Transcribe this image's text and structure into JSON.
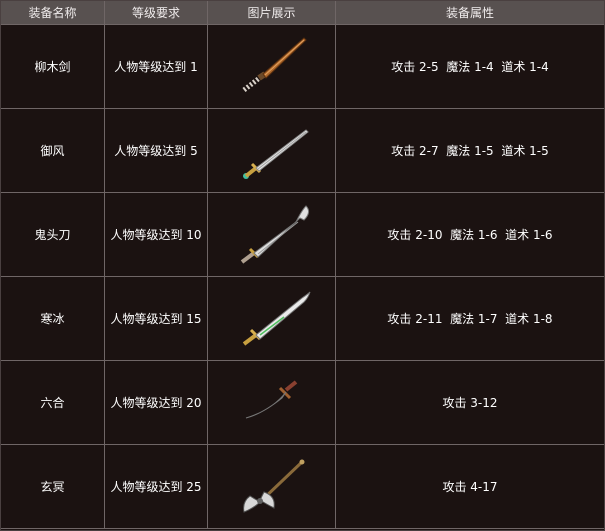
{
  "headers": [
    "装备名称",
    "等级要求",
    "图片展示",
    "装备属性"
  ],
  "rows": [
    {
      "name": "柳木剑",
      "level": "人物等级达到 1",
      "image": "wooden-sword-icon",
      "attributes": "攻击 2-5  魔法 1-4  道术 1-4"
    },
    {
      "name": "御风",
      "level": "人物等级达到 5",
      "image": "wind-sword-icon",
      "attributes": "攻击 2-7  魔法 1-5  道术 1-5"
    },
    {
      "name": "鬼头刀",
      "level": "人物等级达到 10",
      "image": "ghost-blade-icon",
      "attributes": "攻击 2-10  魔法 1-6  道术 1-6"
    },
    {
      "name": "寒冰",
      "level": "人物等级达到 15",
      "image": "ice-sword-icon",
      "attributes": "攻击 2-11  魔法 1-7  道术 1-8"
    },
    {
      "name": "六合",
      "level": "人物等级达到 20",
      "image": "liuhe-dagger-icon",
      "attributes": "攻击 3-12"
    },
    {
      "name": "玄冥",
      "level": "人物等级达到 25",
      "image": "xuanming-axe-icon",
      "attributes": "攻击 4-17"
    }
  ],
  "colors": {
    "header_bg": "#585150",
    "body_bg": "#1b1211",
    "grid": "#6f6666",
    "text": "#ffffff"
  }
}
